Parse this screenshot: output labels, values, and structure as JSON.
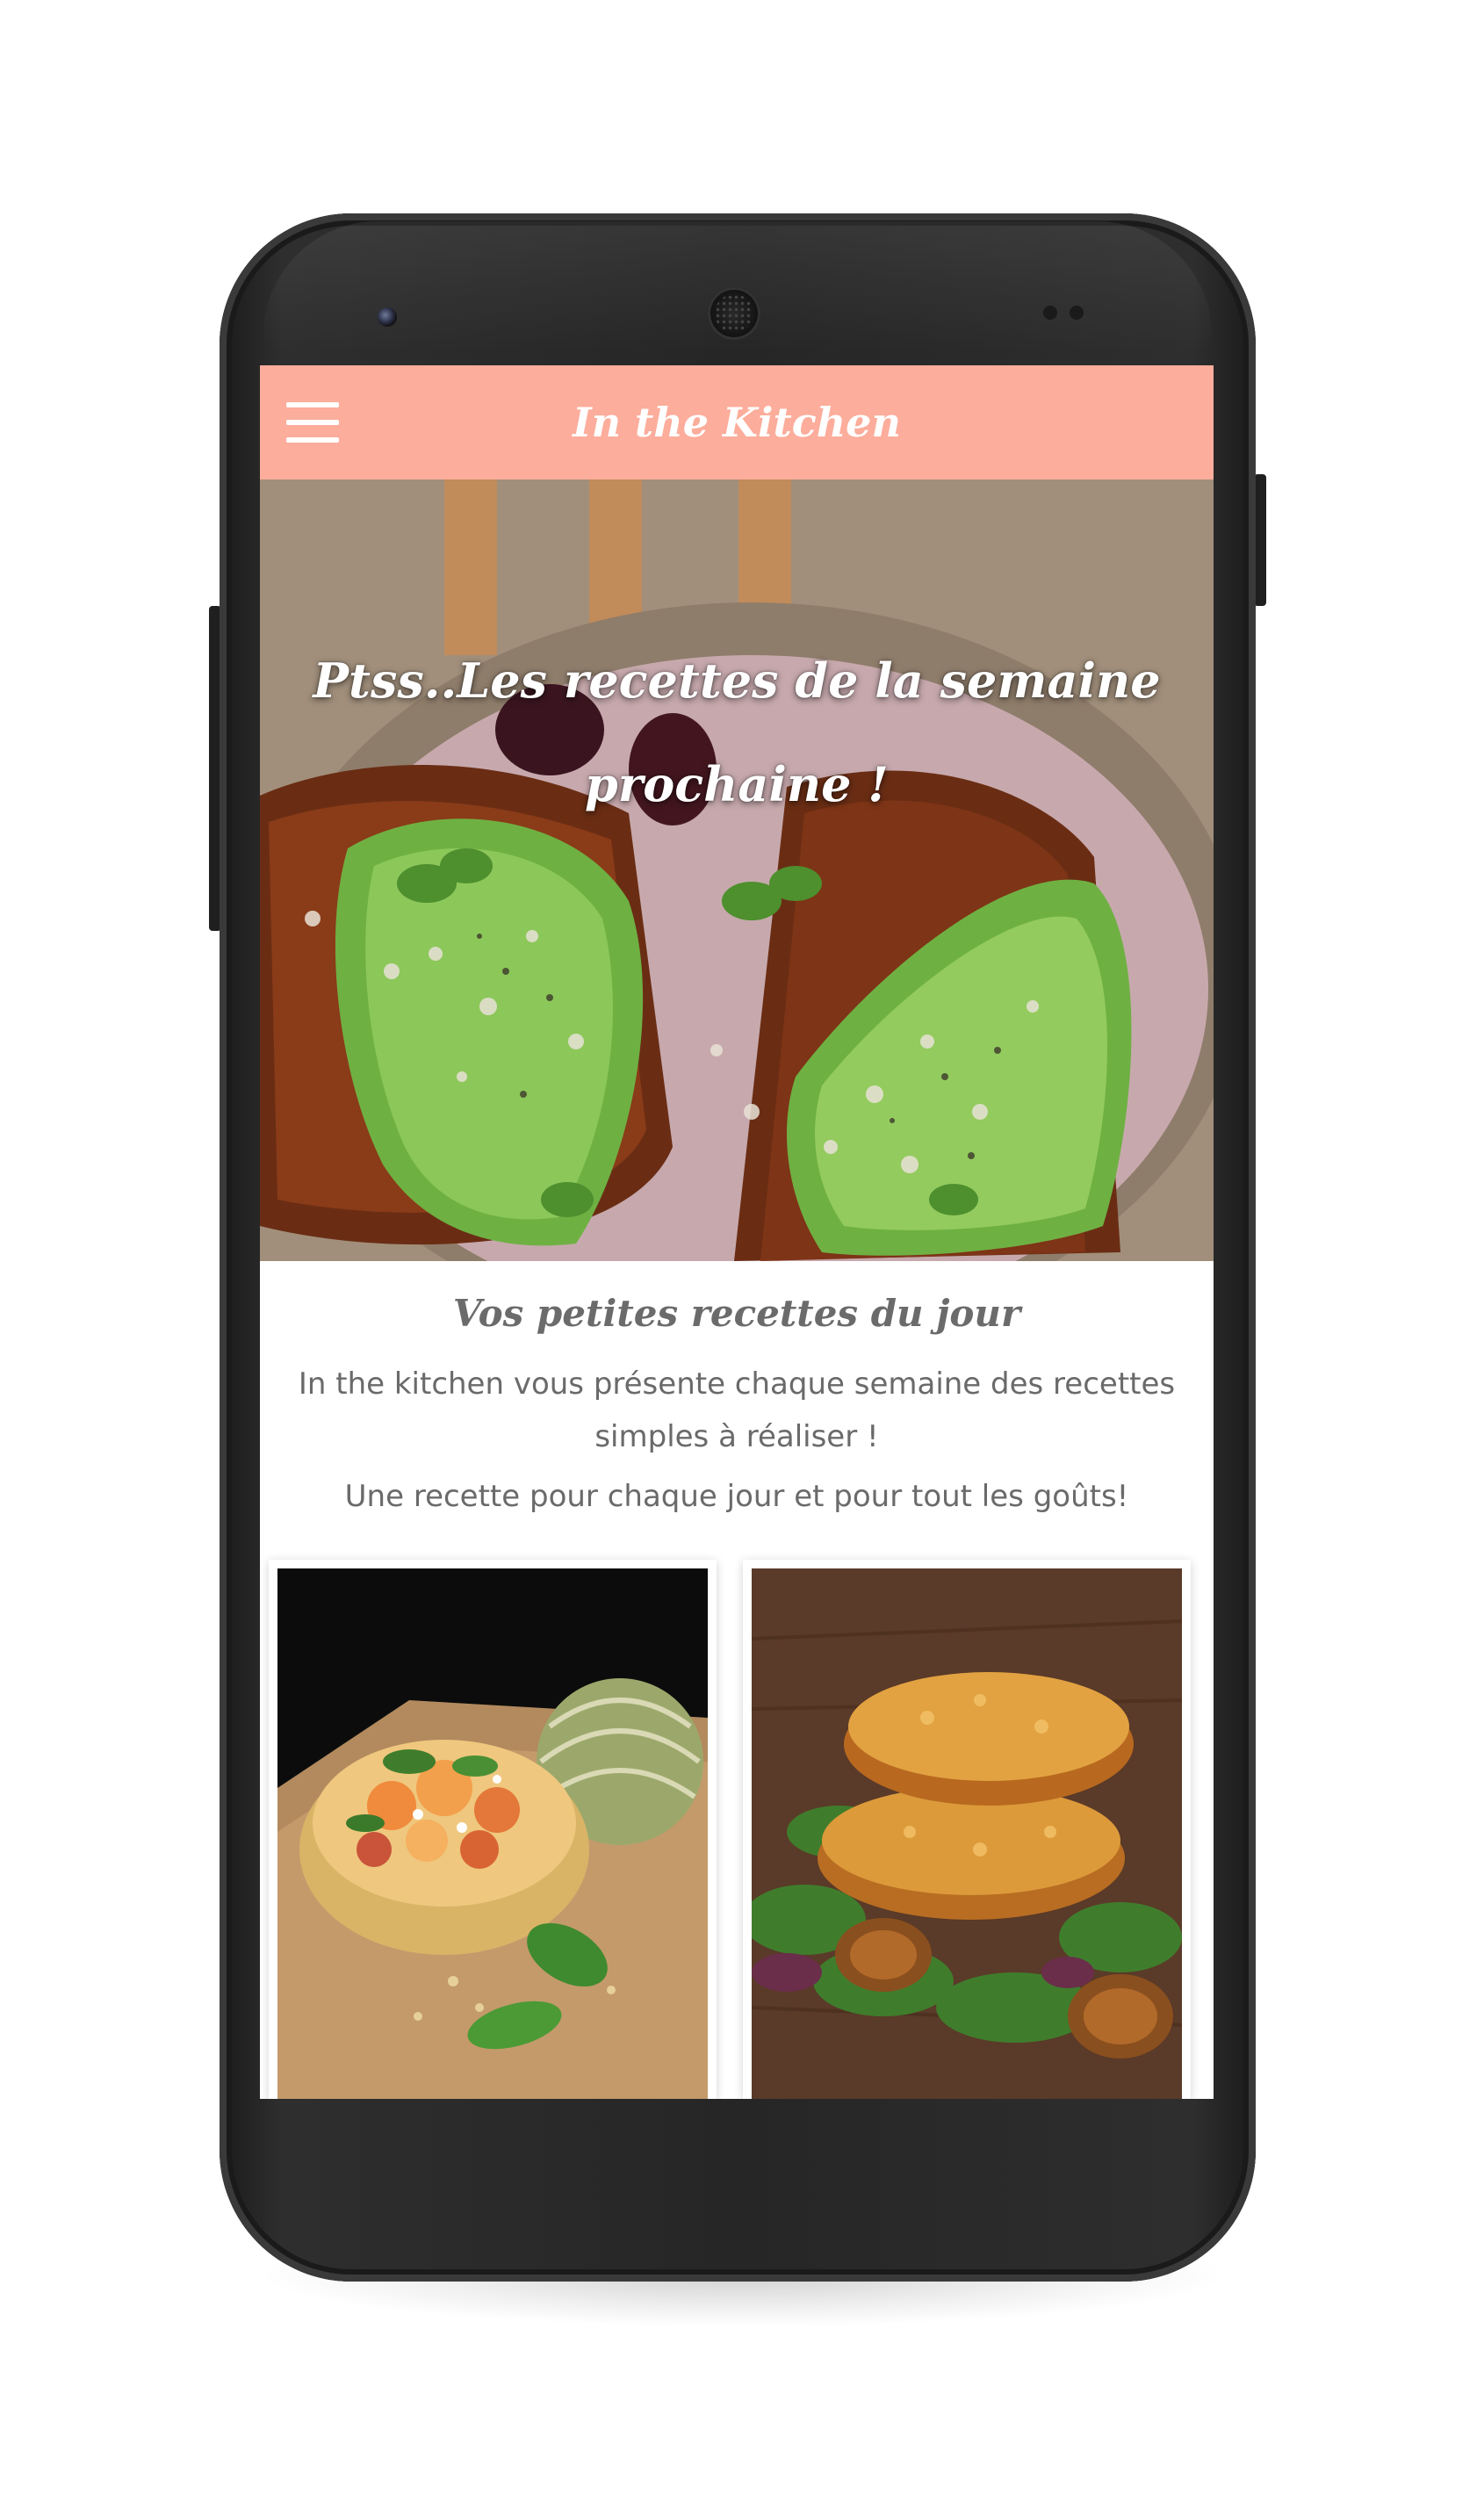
{
  "app_bar": {
    "title": "In the Kitchen",
    "menu_icon": "hamburger-menu-icon",
    "background_color": "#fcad9b"
  },
  "hero": {
    "title": "Ptss..Les recettes de la semaine prochaine !"
  },
  "intro": {
    "section_title": "Vos petites recettes du jour",
    "line_1": "In the kitchen vous présente chaque semaine des recettes simples à réaliser !",
    "line_2": "Une recette pour chaque jour et pour tout les goûts!"
  },
  "recipe_cards": [
    {
      "image": "melon-salad-photo"
    },
    {
      "image": "veggie-patties-photo"
    }
  ]
}
